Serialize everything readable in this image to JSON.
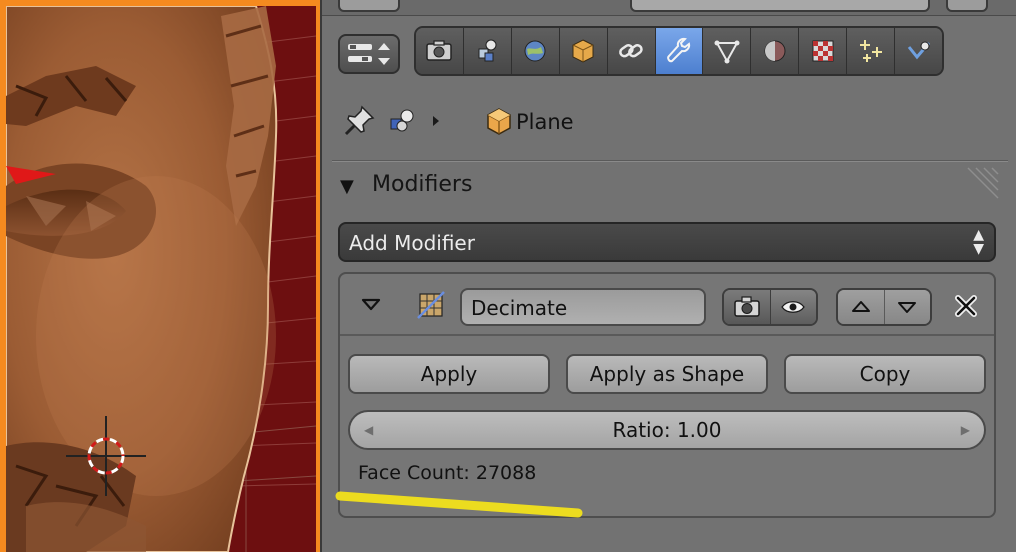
{
  "breadcrumb": {
    "object_name": "Plane"
  },
  "context_tabs": [
    {
      "name": "render-tab",
      "icon": "camera-icon"
    },
    {
      "name": "render-layers-tab",
      "icon": "render-layers-icon"
    },
    {
      "name": "scene-tab",
      "icon": "scene-icon"
    },
    {
      "name": "world-tab",
      "icon": "world-icon"
    },
    {
      "name": "object-tab",
      "icon": "cube-icon"
    },
    {
      "name": "constraints-tab",
      "icon": "chain-link-icon"
    },
    {
      "name": "modifiers-tab",
      "icon": "wrench-icon",
      "active": true
    },
    {
      "name": "data-tab",
      "icon": "mesh-data-icon"
    },
    {
      "name": "material-tab",
      "icon": "material-sphere-icon"
    },
    {
      "name": "texture-tab",
      "icon": "checker-texture-icon"
    },
    {
      "name": "particles-tab",
      "icon": "particles-icon"
    },
    {
      "name": "physics-tab",
      "icon": "physics-icon"
    }
  ],
  "modifiers_panel": {
    "title": "Modifiers",
    "add_modifier_label": "Add Modifier",
    "modifier": {
      "name": "Decimate",
      "buttons": {
        "apply": "Apply",
        "apply_as_shape": "Apply as Shape",
        "copy": "Copy"
      },
      "ratio_label": "Ratio: 1.00",
      "ratio_value": 1.0,
      "face_count_label": "Face Count: 27088"
    }
  },
  "colors": {
    "window_frame": "#f58a1f",
    "active_tab": "#5d8ee0",
    "annotation_highlight": "#f2e21a",
    "panel_bg": "#727272"
  }
}
